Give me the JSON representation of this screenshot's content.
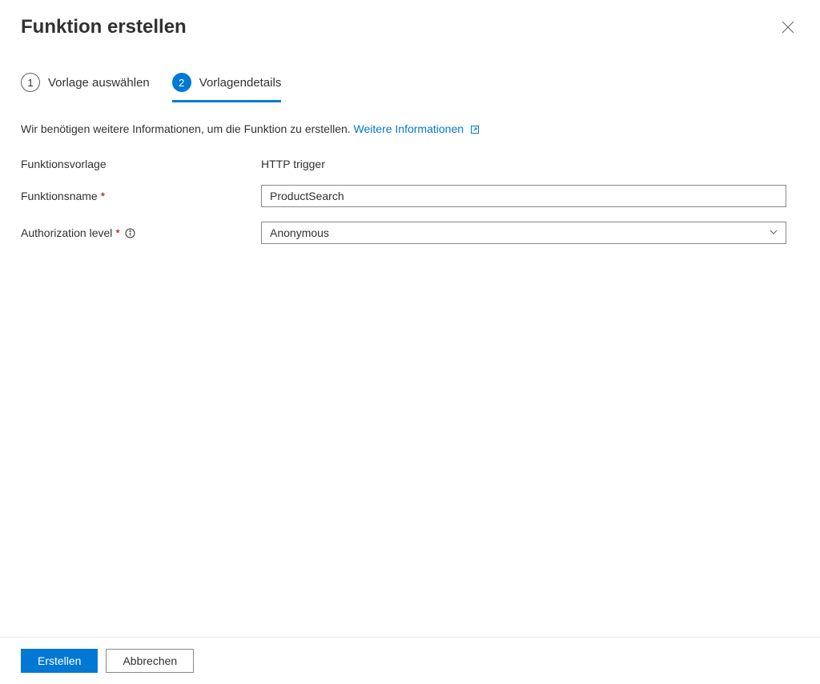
{
  "header": {
    "title": "Funktion erstellen"
  },
  "stepper": {
    "steps": [
      {
        "number": "1",
        "label": "Vorlage auswählen",
        "active": false
      },
      {
        "number": "2",
        "label": "Vorlagendetails",
        "active": true
      }
    ]
  },
  "content": {
    "description": "Wir benötigen weitere Informationen, um die Funktion zu erstellen.",
    "moreInfoLink": "Weitere Informationen"
  },
  "form": {
    "template": {
      "label": "Funktionsvorlage",
      "value": "HTTP trigger"
    },
    "functionName": {
      "label": "Funktionsname",
      "value": "ProductSearch"
    },
    "authLevel": {
      "label": "Authorization level",
      "value": "Anonymous"
    }
  },
  "footer": {
    "createButton": "Erstellen",
    "cancelButton": "Abbrechen"
  }
}
